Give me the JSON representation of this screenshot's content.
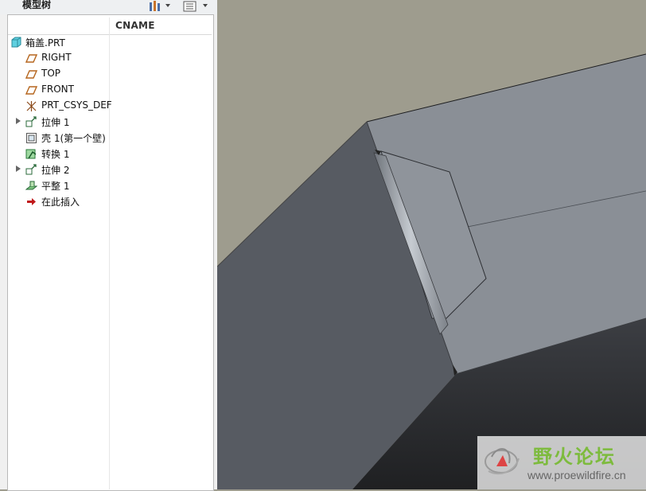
{
  "panel": {
    "title": "模型树",
    "column_header": "CNAME",
    "toolbar": {
      "settings_icon": "tree-settings-icon",
      "show_icon": "show-list-icon"
    }
  },
  "tree": {
    "items": [
      {
        "label": "箱盖.PRT",
        "icon": "part-icon",
        "expandable": false
      },
      {
        "label": "RIGHT",
        "icon": "datum-plane-icon",
        "expandable": false
      },
      {
        "label": "TOP",
        "icon": "datum-plane-icon",
        "expandable": false
      },
      {
        "label": "FRONT",
        "icon": "datum-plane-icon",
        "expandable": false
      },
      {
        "label": "PRT_CSYS_DEF",
        "icon": "csys-icon",
        "expandable": false
      },
      {
        "label": "拉伸 1",
        "icon": "extrude-icon",
        "expandable": true
      },
      {
        "label": "壳 1(第一个壁)",
        "icon": "shell-icon",
        "expandable": false
      },
      {
        "label": "转换 1",
        "icon": "convert-icon",
        "expandable": false
      },
      {
        "label": "拉伸 2",
        "icon": "extrude-icon",
        "expandable": true
      },
      {
        "label": "平整 1",
        "icon": "flat-icon",
        "expandable": false
      },
      {
        "label": "在此插入",
        "icon": "insert-here-icon",
        "expandable": false
      }
    ]
  },
  "watermark": {
    "name": "野火论坛",
    "url": "www.proewildfire.cn"
  },
  "colors": {
    "background": "#9e9c8e",
    "top_face": "#8a8f96",
    "dark_face": "#575b62",
    "shadow": "#2a2b2d"
  }
}
